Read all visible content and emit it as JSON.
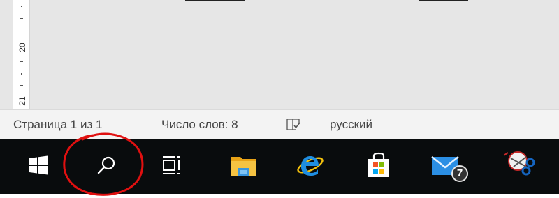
{
  "ruler": {
    "numbers": [
      "20",
      "21"
    ]
  },
  "statusbar": {
    "page_label": "Страница 1 из 1",
    "word_count_label": "Число слов: 8",
    "language_label": "русский",
    "proofing_icon": "proofing-book-icon"
  },
  "taskbar": {
    "items": [
      {
        "name": "start",
        "icon": "windows-logo-icon"
      },
      {
        "name": "search",
        "icon": "search-icon"
      },
      {
        "name": "task-view",
        "icon": "task-view-icon"
      },
      {
        "name": "file-explorer",
        "icon": "folder-icon"
      },
      {
        "name": "internet-explorer",
        "icon": "ie-icon"
      },
      {
        "name": "store",
        "icon": "store-bag-icon"
      },
      {
        "name": "mail",
        "icon": "mail-icon"
      },
      {
        "name": "snipping-tool",
        "icon": "scissors-icon"
      }
    ],
    "mail_badge": "7"
  },
  "colors": {
    "taskbar_bg": "#090c0d",
    "statusbar_bg": "#f3f3f3",
    "document_bg": "#e6e6e6",
    "annotation": "#e01010",
    "ie_blue": "#1f8ee0",
    "folder_yellow": "#f5c342"
  },
  "annotation": {
    "shape": "red-hand-drawn-circle-around-search"
  }
}
